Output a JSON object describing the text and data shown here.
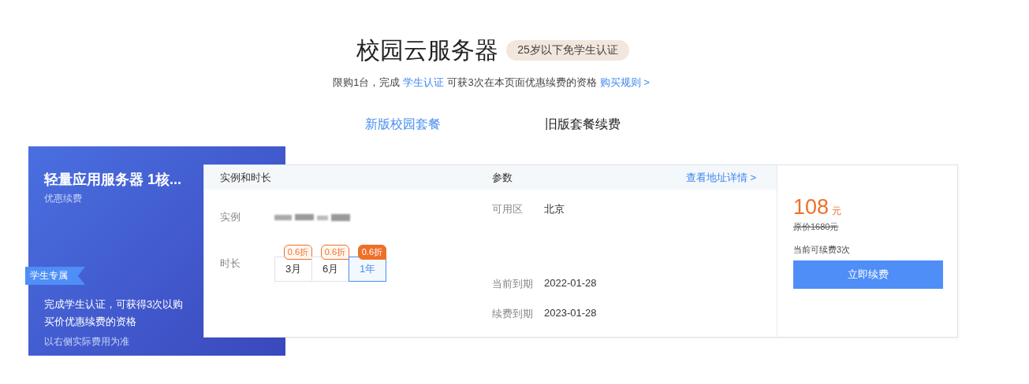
{
  "header": {
    "title": "校园云服务器",
    "badge": "25岁以下免学生认证",
    "notice": {
      "prefix": "限购1台，完成",
      "link": "学生认证",
      "suffix": "可获3次在本页面优惠续费的资格",
      "rules_link": "购买规则 >"
    }
  },
  "tabs": [
    {
      "label": "新版校园套餐",
      "selected": false
    },
    {
      "label": "旧版套餐续费",
      "selected": true
    }
  ],
  "promo_panel": {
    "title": "轻量应用服务器 1核...",
    "subtitle": "优惠续费",
    "ribbon": "学生专属",
    "description": "完成学生认证，可获得3次以购买价优惠续费的资格",
    "note": "以右侧实际费用为准"
  },
  "renewal_card": {
    "header": {
      "column_1": "实例和时长",
      "column_2": "参数",
      "link": "查看地址详情 >"
    },
    "instance_label": "实例",
    "duration_label": "时长",
    "durations": [
      {
        "label": "3月",
        "discount": "0.6折",
        "selected": false
      },
      {
        "label": "6月",
        "discount": "0.6折",
        "selected": false
      },
      {
        "label": "1年",
        "discount": "0.6折",
        "selected": true
      }
    ],
    "params": [
      {
        "label": "可用区",
        "value": "北京"
      },
      {
        "label": "当前到期",
        "value": "2022-01-28"
      },
      {
        "label": "续费到期",
        "value": "2023-01-28"
      }
    ],
    "price": {
      "amount": "108",
      "unit": "元",
      "original": "原价1680元",
      "renewals_left": "当前可续费3次",
      "button": "立即续费"
    }
  }
}
